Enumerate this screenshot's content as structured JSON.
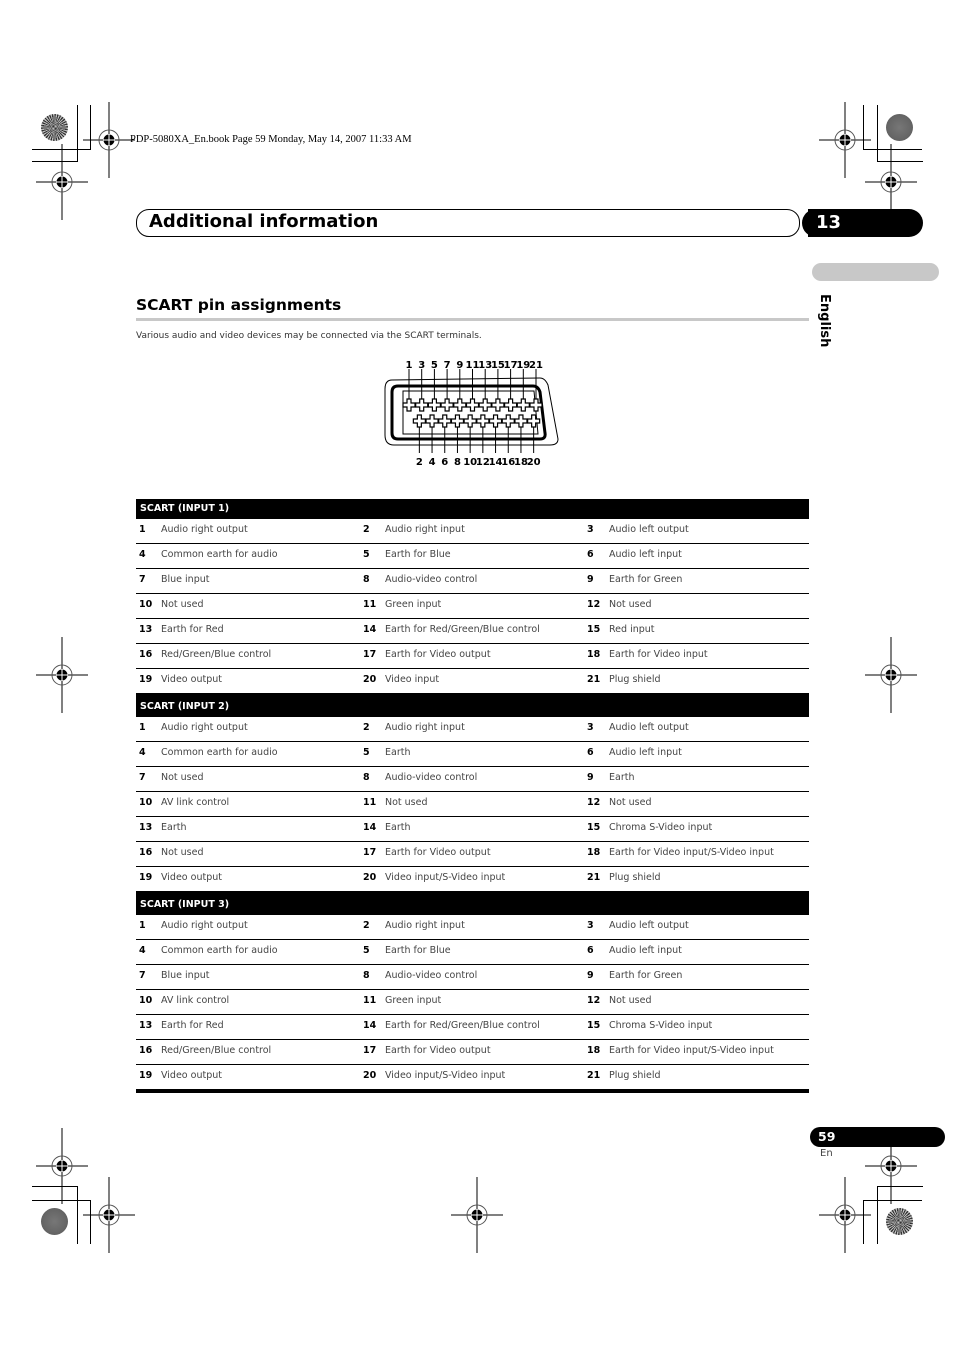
{
  "print_header": "PDP-5080XA_En.book  Page 59  Monday, May 14, 2007  11:33 AM",
  "chapter": {
    "title": "Additional information",
    "number": "13"
  },
  "language_tab": "English",
  "section": {
    "title": "SCART pin assignments",
    "intro": "Various audio and video devices may be connected via the SCART terminals."
  },
  "connector": {
    "top_pins": [
      "1",
      "3",
      "5",
      "7",
      "9",
      "11",
      "13",
      "15",
      "17",
      "19",
      "21"
    ],
    "bottom_pins": [
      "2",
      "4",
      "6",
      "8",
      "10",
      "12",
      "14",
      "16",
      "18",
      "20"
    ]
  },
  "tables": [
    {
      "title": "SCART (INPUT 1)",
      "rows": [
        [
          [
            "1",
            "Audio right output"
          ],
          [
            "2",
            "Audio right input"
          ],
          [
            "3",
            "Audio left output"
          ]
        ],
        [
          [
            "4",
            "Common earth for audio"
          ],
          [
            "5",
            "Earth for Blue"
          ],
          [
            "6",
            "Audio left input"
          ]
        ],
        [
          [
            "7",
            "Blue input"
          ],
          [
            "8",
            "Audio-video control"
          ],
          [
            "9",
            "Earth for Green"
          ]
        ],
        [
          [
            "10",
            "Not used"
          ],
          [
            "11",
            "Green input"
          ],
          [
            "12",
            "Not used"
          ]
        ],
        [
          [
            "13",
            "Earth for Red"
          ],
          [
            "14",
            "Earth for Red/Green/Blue control"
          ],
          [
            "15",
            "Red input"
          ]
        ],
        [
          [
            "16",
            "Red/Green/Blue control"
          ],
          [
            "17",
            "Earth for Video output"
          ],
          [
            "18",
            "Earth for Video input"
          ]
        ],
        [
          [
            "19",
            "Video output"
          ],
          [
            "20",
            "Video input"
          ],
          [
            "21",
            "Plug shield"
          ]
        ]
      ]
    },
    {
      "title": "SCART (INPUT 2)",
      "rows": [
        [
          [
            "1",
            "Audio right output"
          ],
          [
            "2",
            "Audio right input"
          ],
          [
            "3",
            "Audio left output"
          ]
        ],
        [
          [
            "4",
            "Common earth for audio"
          ],
          [
            "5",
            "Earth"
          ],
          [
            "6",
            "Audio left input"
          ]
        ],
        [
          [
            "7",
            "Not used"
          ],
          [
            "8",
            "Audio-video control"
          ],
          [
            "9",
            "Earth"
          ]
        ],
        [
          [
            "10",
            "AV link control"
          ],
          [
            "11",
            "Not used"
          ],
          [
            "12",
            "Not used"
          ]
        ],
        [
          [
            "13",
            "Earth"
          ],
          [
            "14",
            "Earth"
          ],
          [
            "15",
            "Chroma S-Video input"
          ]
        ],
        [
          [
            "16",
            "Not used"
          ],
          [
            "17",
            "Earth for Video output"
          ],
          [
            "18",
            "Earth for Video input/S-Video input"
          ]
        ],
        [
          [
            "19",
            "Video output"
          ],
          [
            "20",
            "Video input/S-Video input"
          ],
          [
            "21",
            "Plug shield"
          ]
        ]
      ]
    },
    {
      "title": "SCART (INPUT 3)",
      "rows": [
        [
          [
            "1",
            "Audio right output"
          ],
          [
            "2",
            "Audio right input"
          ],
          [
            "3",
            "Audio left output"
          ]
        ],
        [
          [
            "4",
            "Common earth for audio"
          ],
          [
            "5",
            "Earth for Blue"
          ],
          [
            "6",
            "Audio left input"
          ]
        ],
        [
          [
            "7",
            "Blue input"
          ],
          [
            "8",
            "Audio-video control"
          ],
          [
            "9",
            "Earth for Green"
          ]
        ],
        [
          [
            "10",
            "AV link control"
          ],
          [
            "11",
            "Green input"
          ],
          [
            "12",
            "Not used"
          ]
        ],
        [
          [
            "13",
            "Earth for Red"
          ],
          [
            "14",
            "Earth for Red/Green/Blue control"
          ],
          [
            "15",
            "Chroma S-Video input"
          ]
        ],
        [
          [
            "16",
            "Red/Green/Blue control"
          ],
          [
            "17",
            "Earth for Video output"
          ],
          [
            "18",
            "Earth for Video input/S-Video input"
          ]
        ],
        [
          [
            "19",
            "Video output"
          ],
          [
            "20",
            "Video input/S-Video input"
          ],
          [
            "21",
            "Plug shield"
          ]
        ]
      ]
    }
  ],
  "footer": {
    "page_number": "59",
    "language": "En"
  }
}
